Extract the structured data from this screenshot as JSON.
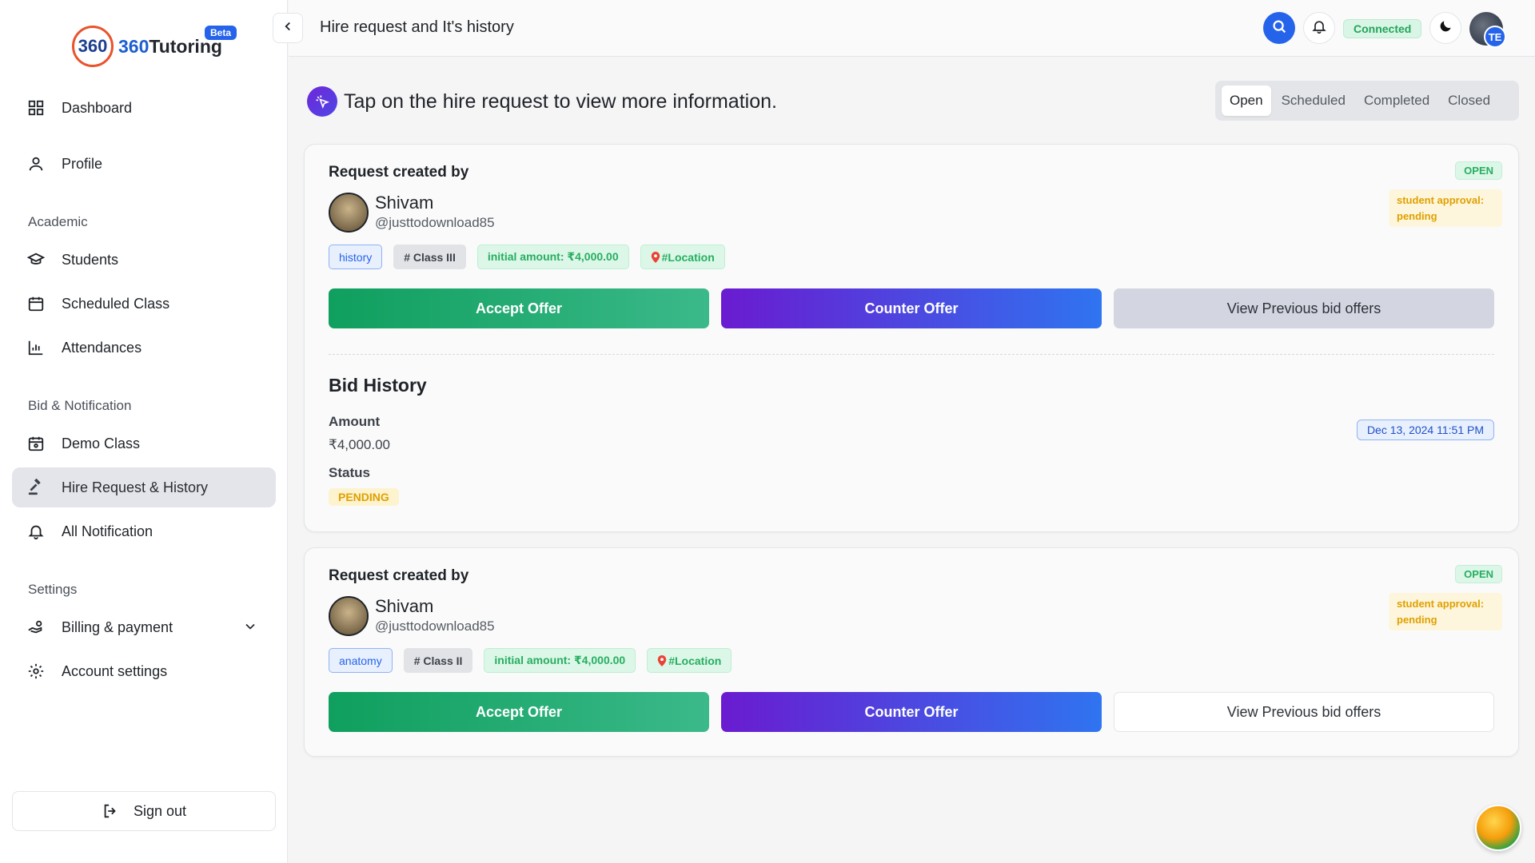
{
  "brand": {
    "name_prefix": "360",
    "name_suffix": "Tutoring",
    "beta": "Beta",
    "logo_mark": "360"
  },
  "sidebar": {
    "items": [
      {
        "label": "Dashboard",
        "icon": "grid-icon"
      },
      {
        "label": "Profile",
        "icon": "user-icon"
      },
      {
        "label": "Students",
        "icon": "graduation-cap-icon"
      },
      {
        "label": "Scheduled Class",
        "icon": "calendar-icon"
      },
      {
        "label": "Attendances",
        "icon": "bar-chart-icon"
      },
      {
        "label": "Demo Class",
        "icon": "calendar-video-icon"
      },
      {
        "label": "Hire Request & History",
        "icon": "gavel-icon",
        "active": true
      },
      {
        "label": "All Notification",
        "icon": "bell-icon"
      },
      {
        "label": "Billing & payment",
        "icon": "hand-coins-icon"
      },
      {
        "label": "Account settings",
        "icon": "gear-icon"
      }
    ],
    "sections": {
      "academic": "Academic",
      "bid": "Bid & Notification",
      "settings": "Settings"
    },
    "signout": "Sign out"
  },
  "header": {
    "title": "Hire request and It's history",
    "status": "Connected",
    "avatar_initials": "TE"
  },
  "intro": "Tap on the hire request to view more information.",
  "tabs": [
    "Open",
    "Scheduled",
    "Completed",
    "Closed"
  ],
  "active_tab": "Open",
  "requests": [
    {
      "created_by_label": "Request created by",
      "name": "Shivam",
      "handle": "@justtodownload85",
      "status": "OPEN",
      "approval": "student approval: pending",
      "subject": "history",
      "class": "# Class III",
      "amount": "initial amount: ₹4,000.00",
      "location": "#Location",
      "accept": "Accept Offer",
      "counter": "Counter Offer",
      "previous": "View Previous bid offers",
      "bid_history": {
        "title": "Bid History",
        "amount_label": "Amount",
        "amount": "₹4,000.00",
        "status_label": "Status",
        "status": "PENDING",
        "date": "Dec 13, 2024 11:51 PM"
      }
    },
    {
      "created_by_label": "Request created by",
      "name": "Shivam",
      "handle": "@justtodownload85",
      "status": "OPEN",
      "approval": "student approval: pending",
      "subject": "anatomy",
      "class": "# Class II",
      "amount": "initial amount: ₹4,000.00",
      "location": "#Location",
      "accept": "Accept Offer",
      "counter": "Counter Offer",
      "previous": "View Previous bid offers"
    }
  ],
  "colors": {
    "accent": "#2563eb",
    "success": "#27ae60",
    "warning": "#e0a000",
    "counter_start": "#6a1bd0",
    "counter_end": "#2f74f0"
  }
}
